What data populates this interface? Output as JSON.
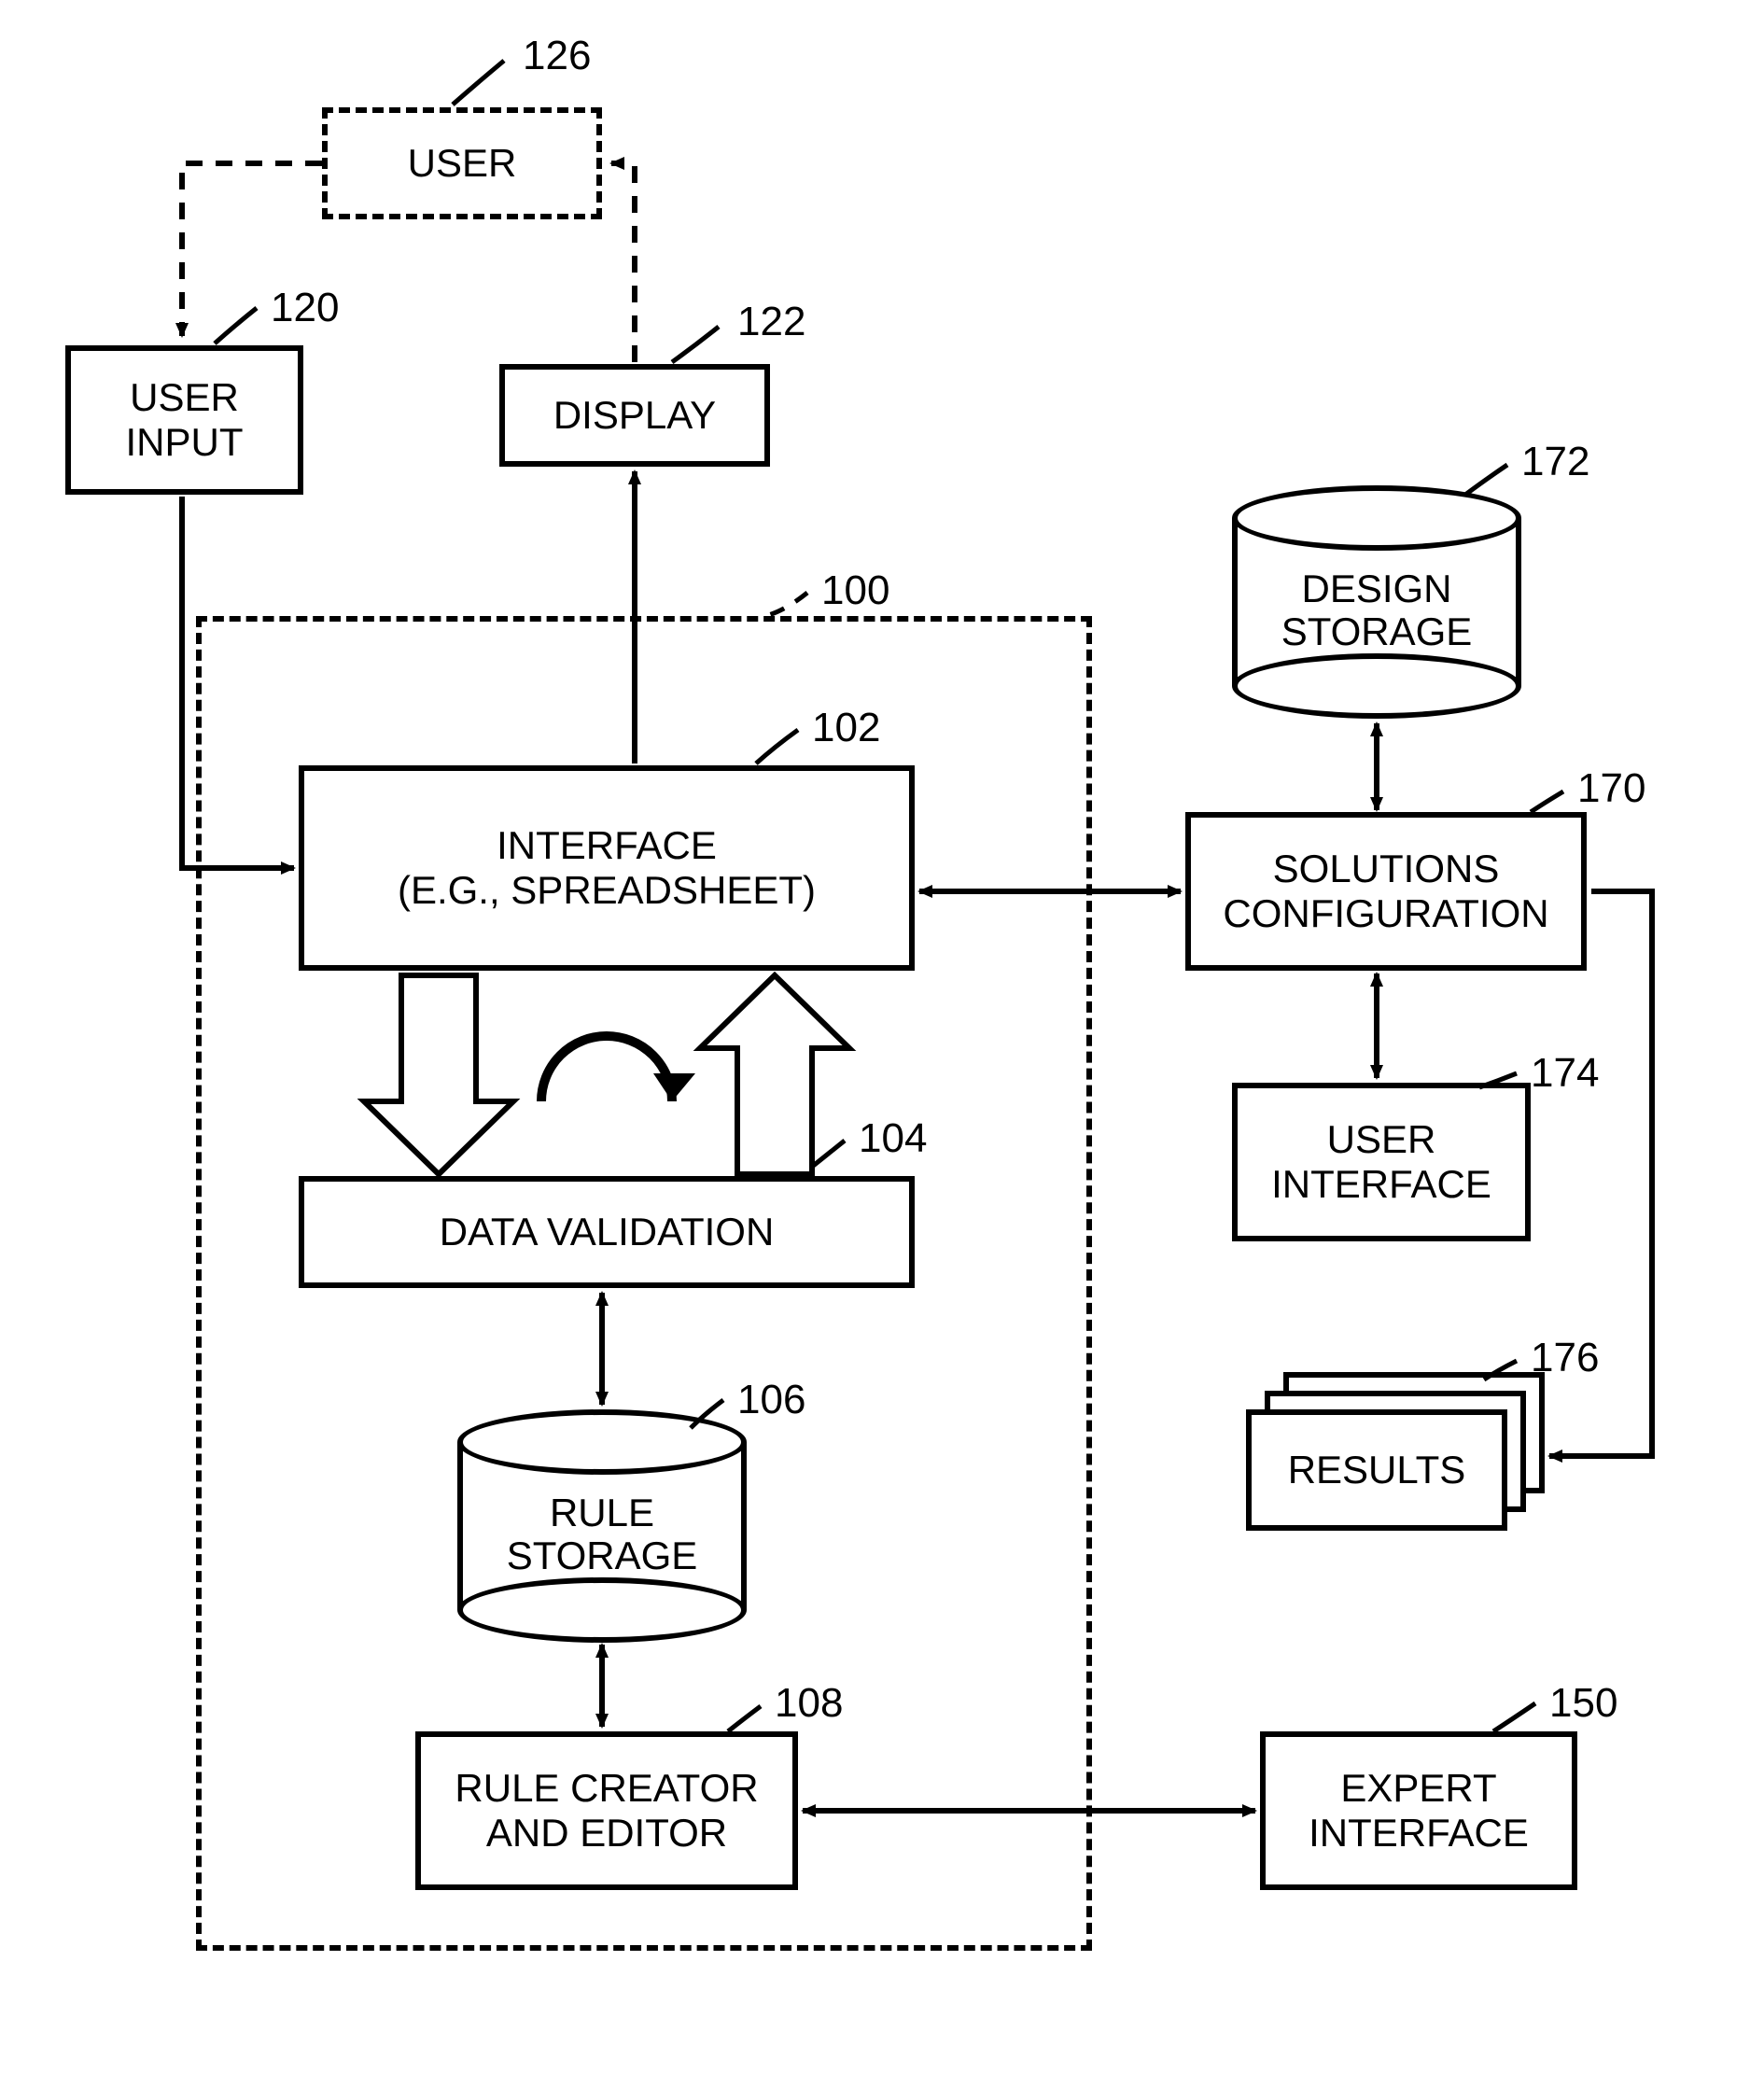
{
  "refs": {
    "user": "126",
    "user_input": "120",
    "display": "122",
    "container": "100",
    "interface": "102",
    "data_validation": "104",
    "rule_storage": "106",
    "rule_creator": "108",
    "expert_interface": "150",
    "solutions_config": "170",
    "design_storage": "172",
    "user_interface_2": "174",
    "results": "176"
  },
  "boxes": {
    "user": "USER",
    "user_input": "USER\nINPUT",
    "display": "DISPLAY",
    "interface": "INTERFACE\n(E.G., SPREADSHEET)",
    "data_validation": "DATA VALIDATION",
    "rule_storage": "RULE\nSTORAGE",
    "rule_creator": "RULE CREATOR\nAND EDITOR",
    "expert_interface": "EXPERT\nINTERFACE",
    "solutions_config": "SOLUTIONS\nCONFIGURATION",
    "design_storage": "DESIGN\nSTORAGE",
    "user_interface_2": "USER\nINTERFACE",
    "results": "RESULTS"
  }
}
